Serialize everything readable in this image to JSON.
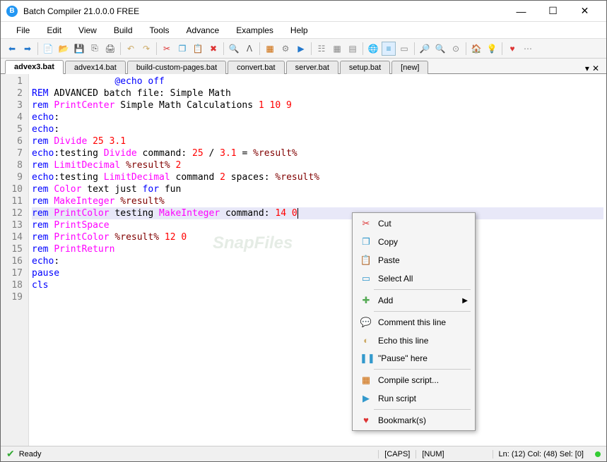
{
  "titlebar": {
    "title": "Batch Compiler 21.0.0.0 FREE"
  },
  "menubar": {
    "items": [
      "File",
      "Edit",
      "View",
      "Build",
      "Tools",
      "Advance",
      "Examples",
      "Help"
    ]
  },
  "tabs": {
    "items": [
      "advex3.bat",
      "advex14.bat",
      "build-custom-pages.bat",
      "convert.bat",
      "server.bat",
      "setup.bat",
      "[new]"
    ],
    "active": 0
  },
  "code": {
    "lines": [
      [
        {
          "t": "               ",
          "c": "txt"
        },
        {
          "t": "@echo off",
          "c": "kw-rem"
        }
      ],
      [
        {
          "t": "REM",
          "c": "kw-rem"
        },
        {
          "t": " ADVANCED batch file: Simple Math",
          "c": "txt"
        }
      ],
      [
        {
          "t": "rem",
          "c": "kw-cmd"
        },
        {
          "t": " ",
          "c": "txt"
        },
        {
          "t": "PrintCenter",
          "c": "kw-func"
        },
        {
          "t": " Simple Math Calculations ",
          "c": "txt"
        },
        {
          "t": "1 10 9",
          "c": "kw-num"
        }
      ],
      [
        {
          "t": "echo",
          "c": "kw-echo"
        },
        {
          "t": ":",
          "c": "txt"
        }
      ],
      [
        {
          "t": "echo",
          "c": "kw-echo"
        },
        {
          "t": ":",
          "c": "txt"
        }
      ],
      [
        {
          "t": "rem",
          "c": "kw-cmd"
        },
        {
          "t": " ",
          "c": "txt"
        },
        {
          "t": "Divide",
          "c": "kw-func"
        },
        {
          "t": " ",
          "c": "txt"
        },
        {
          "t": "25 3.1",
          "c": "kw-num"
        }
      ],
      [
        {
          "t": "echo",
          "c": "kw-echo"
        },
        {
          "t": ":testing ",
          "c": "txt"
        },
        {
          "t": "Divide",
          "c": "kw-func"
        },
        {
          "t": " command: ",
          "c": "txt"
        },
        {
          "t": "25",
          "c": "kw-num"
        },
        {
          "t": " / ",
          "c": "txt"
        },
        {
          "t": "3.1",
          "c": "kw-num"
        },
        {
          "t": " = ",
          "c": "txt"
        },
        {
          "t": "%result%",
          "c": "kw-var"
        }
      ],
      [
        {
          "t": "rem",
          "c": "kw-cmd"
        },
        {
          "t": " ",
          "c": "txt"
        },
        {
          "t": "LimitDecimal",
          "c": "kw-func"
        },
        {
          "t": " ",
          "c": "txt"
        },
        {
          "t": "%result%",
          "c": "kw-var"
        },
        {
          "t": " ",
          "c": "txt"
        },
        {
          "t": "2",
          "c": "kw-num"
        }
      ],
      [
        {
          "t": "echo",
          "c": "kw-echo"
        },
        {
          "t": ":testing ",
          "c": "txt"
        },
        {
          "t": "LimitDecimal",
          "c": "kw-func"
        },
        {
          "t": " command ",
          "c": "txt"
        },
        {
          "t": "2",
          "c": "kw-num"
        },
        {
          "t": " spaces: ",
          "c": "txt"
        },
        {
          "t": "%result%",
          "c": "kw-var"
        }
      ],
      [
        {
          "t": "rem",
          "c": "kw-cmd"
        },
        {
          "t": " ",
          "c": "txt"
        },
        {
          "t": "Color",
          "c": "kw-func"
        },
        {
          "t": " text just ",
          "c": "txt"
        },
        {
          "t": "for",
          "c": "kw-cmd"
        },
        {
          "t": " fun",
          "c": "txt"
        }
      ],
      [
        {
          "t": "rem",
          "c": "kw-cmd"
        },
        {
          "t": " ",
          "c": "txt"
        },
        {
          "t": "MakeInteger",
          "c": "kw-func"
        },
        {
          "t": " ",
          "c": "txt"
        },
        {
          "t": "%result%",
          "c": "kw-var"
        }
      ],
      [
        {
          "t": "rem",
          "c": "kw-cmd"
        },
        {
          "t": " ",
          "c": "txt"
        },
        {
          "t": "PrintColor",
          "c": "kw-func"
        },
        {
          "t": " testing ",
          "c": "txt"
        },
        {
          "t": "MakeInteger",
          "c": "kw-func"
        },
        {
          "t": " command: ",
          "c": "txt"
        },
        {
          "t": "14 0",
          "c": "kw-num"
        }
      ],
      [
        {
          "t": "rem",
          "c": "kw-cmd"
        },
        {
          "t": " ",
          "c": "txt"
        },
        {
          "t": "PrintSpace",
          "c": "kw-func"
        }
      ],
      [
        {
          "t": "rem",
          "c": "kw-cmd"
        },
        {
          "t": " ",
          "c": "txt"
        },
        {
          "t": "PrintColor",
          "c": "kw-func"
        },
        {
          "t": " ",
          "c": "txt"
        },
        {
          "t": "%result%",
          "c": "kw-var"
        },
        {
          "t": " ",
          "c": "txt"
        },
        {
          "t": "12 0",
          "c": "kw-num"
        }
      ],
      [
        {
          "t": "rem",
          "c": "kw-cmd"
        },
        {
          "t": " ",
          "c": "txt"
        },
        {
          "t": "PrintReturn",
          "c": "kw-func"
        }
      ],
      [
        {
          "t": "echo",
          "c": "kw-echo"
        },
        {
          "t": ":",
          "c": "txt"
        }
      ],
      [
        {
          "t": "pause",
          "c": "kw-cmd"
        }
      ],
      [
        {
          "t": "cls",
          "c": "kw-cmd"
        }
      ],
      []
    ],
    "highlighted_line": 12
  },
  "context_menu": {
    "items": [
      {
        "icon": "✂",
        "label": "Cut",
        "color": "#d33"
      },
      {
        "icon": "❐",
        "label": "Copy",
        "color": "#39c"
      },
      {
        "icon": "📋",
        "label": "Paste",
        "color": "#888"
      },
      {
        "icon": "▭",
        "label": "Select All",
        "color": "#39c"
      },
      {
        "sep": true
      },
      {
        "icon": "✚",
        "label": "Add",
        "color": "#5a5",
        "arrow": true
      },
      {
        "sep": true
      },
      {
        "icon": "💬",
        "label": "Comment this line",
        "color": "#ca6"
      },
      {
        "icon": "◐",
        "label": "Echo this line",
        "color": "#ca6"
      },
      {
        "icon": "❚❚",
        "label": "\"Pause\" here",
        "color": "#39c"
      },
      {
        "sep": true
      },
      {
        "icon": "▦",
        "label": "Compile script...",
        "color": "#c60"
      },
      {
        "icon": "▶",
        "label": "Run script",
        "color": "#39c"
      },
      {
        "sep": true
      },
      {
        "icon": "♥",
        "label": "Bookmark(s)",
        "color": "#d33"
      }
    ]
  },
  "statusbar": {
    "ready": "Ready",
    "caps": "[CAPS]",
    "num": "[NUM]",
    "pos": "Ln: (12) Col: (48) Sel: [0]"
  },
  "watermark": "SnapFiles"
}
